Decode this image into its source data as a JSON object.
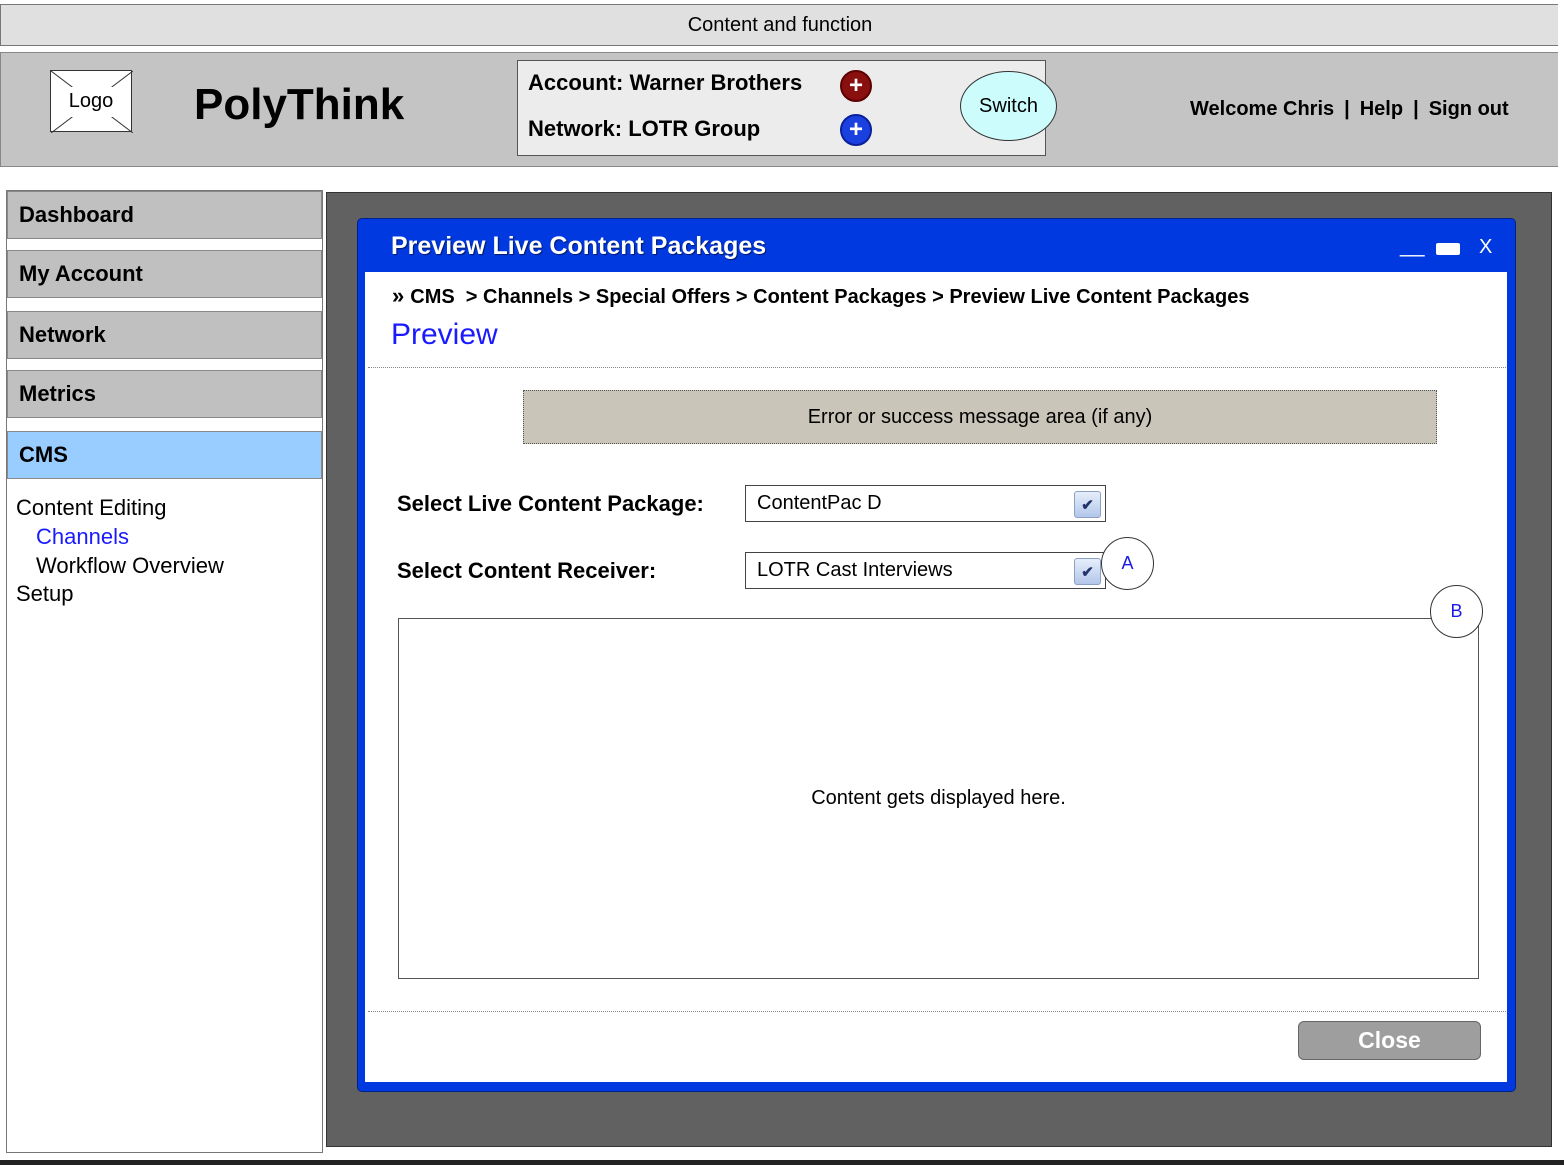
{
  "topbar": {
    "text": "Content and function"
  },
  "header": {
    "logo_text": "Logo",
    "app_name": "PolyThink",
    "account_label": "Account: Warner Brothers",
    "network_label": "Network: LOTR Group",
    "add_icon_glyph": "+",
    "switch_label": "Switch",
    "user_nav": {
      "welcome": "Welcome Chris",
      "help": "Help",
      "signout": "Sign out",
      "separator": "|"
    }
  },
  "sidebar": {
    "items": [
      {
        "label": "Dashboard"
      },
      {
        "label": "My Account"
      },
      {
        "label": "Network"
      },
      {
        "label": "Metrics"
      },
      {
        "label": "CMS",
        "active": true
      }
    ],
    "submenu": {
      "content_editing": "Content Editing",
      "channels": "Channels",
      "workflow": "Workflow Overview",
      "setup": "Setup"
    }
  },
  "dialog": {
    "title": "Preview Live Content Packages",
    "controls": {
      "minimize": "__",
      "close": "X"
    },
    "breadcrumb": {
      "marker": "»",
      "path": "CMS  > Channels > Special Offers > Content Packages > Preview Live Content Packages"
    },
    "page_title": "Preview",
    "message_area": "Error or success message area (if any)",
    "fields": {
      "package_label": "Select Live Content Package:",
      "package_value": "ContentPac D",
      "receiver_label": "Select Content Receiver:",
      "receiver_value": "LOTR Cast Interviews"
    },
    "markers": {
      "a": "A",
      "b": "B"
    },
    "content_placeholder": "Content gets displayed here.",
    "close_label": "Close"
  },
  "colors": {
    "dialog_blue": "#0039e0",
    "cms_active": "#99ccff",
    "link_blue": "#1a1aff",
    "account_add": "#8a1010",
    "network_add": "#1a40e0",
    "switch_fill": "#cdfcfc",
    "message_area": "#c9c6b9"
  },
  "icons": {
    "account_add": "plus-octagon-icon",
    "network_add": "plus-octagon-icon",
    "dropdown": "chevron-down-icon"
  }
}
